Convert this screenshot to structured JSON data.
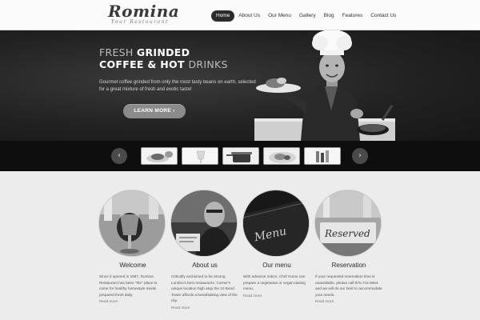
{
  "brand": {
    "name": "Romina",
    "tagline": "Your Restaurant"
  },
  "nav": [
    {
      "label": "Home",
      "active": true
    },
    {
      "label": "About Us",
      "active": false
    },
    {
      "label": "Our Menu",
      "active": false
    },
    {
      "label": "Gallery",
      "active": false
    },
    {
      "label": "Blog",
      "active": false
    },
    {
      "label": "Features",
      "active": false
    },
    {
      "label": "Contact Us",
      "active": false
    }
  ],
  "hero": {
    "title_line1_light": "FRESH ",
    "title_line1_bold": "GRINDED",
    "title_line2_bold": "COFFEE & HOT ",
    "title_line2_light": "DRINKS",
    "description": "Gourmet coffee grinded from only the most tasty beans on earth, selected for a great mixture of fresh and exotic taste!",
    "button_label": "LEARN MORE",
    "button_arrow": "›"
  },
  "slider": {
    "prev_arrow": "‹",
    "next_arrow": "›",
    "thumbnails": [
      "thumb-dish-1",
      "thumb-dish-2",
      "thumb-dish-3",
      "thumb-dish-4",
      "thumb-dish-5"
    ]
  },
  "columns": [
    {
      "title": "Welcome",
      "text": "Since it opened in 1997, Romina Restaurant has been \"the\" place to come for healthy homestyle meals prepared fresh daily.",
      "link": "Read more"
    },
    {
      "title": "About us",
      "text": "Critically acclaimed to be among London's best restaurants. Corner's unique location high atop the 10 Bond Tower affords a breathtaking view of the city.",
      "link": "Read more"
    },
    {
      "title": "Our menu",
      "text": "With advance notice, Chef Home can prepare a vegetarian or vegan tasting menu.",
      "link": "Read more"
    },
    {
      "title": "Reservation",
      "text": "If your requested reservation time is unavailable, please call 876.744.9654 and we will do our best to accommodate your needs.",
      "link": "Read more"
    }
  ],
  "colors": {
    "header_bg": "#fbfbfb",
    "hero_bg": "#222222",
    "strip_bg": "#0e0e0e",
    "button_bg": "#8b8b8b",
    "content_bg": "#ececec"
  }
}
